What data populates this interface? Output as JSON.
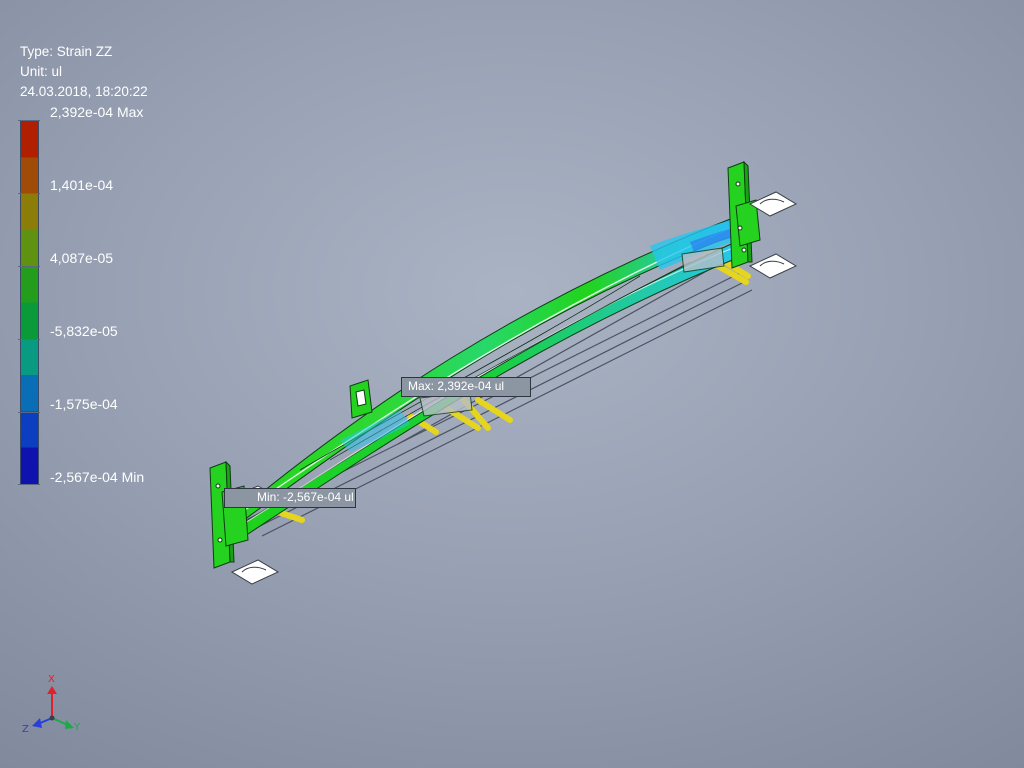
{
  "result_info": {
    "type_line": "Type: Strain ZZ",
    "unit_line": "Unit: ul",
    "date_line": "24.03.2018, 18:20:22"
  },
  "legend": {
    "labels": [
      "2,392e-04 Max",
      "1,401e-04",
      "4,087e-05",
      "-5,832e-05",
      "-1,575e-04",
      "-2,567e-04 Min"
    ],
    "max_value": 0.0002392,
    "min_value": -0.0002567
  },
  "probes": {
    "max_text": "Max: 2,392e-04 ul",
    "min_text": "Min: -2,567e-04 ul"
  },
  "triad": {
    "x_label": "X",
    "y_label": "Y",
    "z_label": "Z"
  },
  "colors": {
    "strain_green": "#22d41c",
    "strain_cyan": "#27c6ee",
    "strain_blue": "#2c7df0",
    "rod_yellow": "#e6d51e",
    "triad_x": "#e0202a",
    "triad_y": "#1fa84a",
    "triad_z": "#2b3fd8"
  }
}
